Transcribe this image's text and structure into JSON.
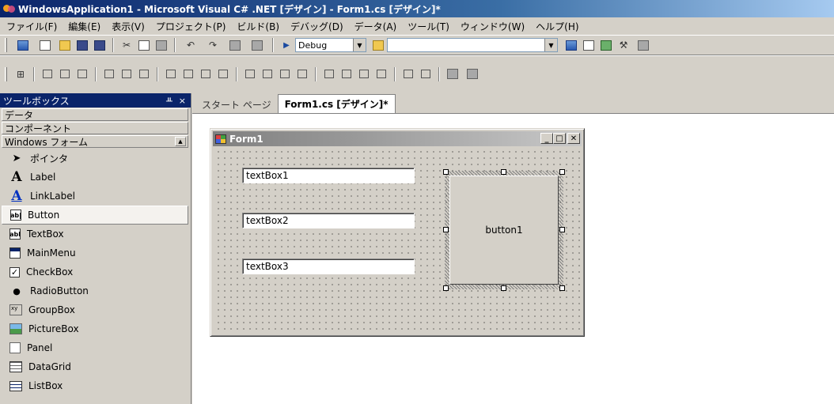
{
  "window": {
    "title": "WindowsApplication1 - Microsoft Visual C# .NET [デザイン] - Form1.cs [デザイン]*"
  },
  "menu": [
    "ファイル(F)",
    "編集(E)",
    "表示(V)",
    "プロジェクト(P)",
    "ビルド(B)",
    "デバッグ(D)",
    "データ(A)",
    "ツール(T)",
    "ウィンドウ(W)",
    "ヘルプ(H)"
  ],
  "toolbar": {
    "config_value": "Debug",
    "find_value": ""
  },
  "toolbox": {
    "title": "ツールボックス",
    "pin_glyph": "ᚇ",
    "close_glyph": "×",
    "sections": {
      "data": "データ",
      "components": "コンポーネント",
      "winforms": "Windows フォーム"
    },
    "items": [
      "ポインタ",
      "Label",
      "LinkLabel",
      "Button",
      "TextBox",
      "MainMenu",
      "CheckBox",
      "RadioButton",
      "GroupBox",
      "PictureBox",
      "Panel",
      "DataGrid",
      "ListBox"
    ],
    "icon_text": {
      "label": "A",
      "linklabel": "A",
      "button": "ab|",
      "textbox": "abl",
      "checkbox": "✓",
      "radio": "●",
      "group": "xy"
    }
  },
  "tabs": [
    "スタート ページ",
    "Form1.cs [デザイン]*"
  ],
  "form": {
    "title": "Form1",
    "textboxes": [
      "textBox1",
      "textBox2",
      "textBox3"
    ],
    "button_label": "button1"
  },
  "colors": {
    "title_active": "#0a246a",
    "form_title": "#808080",
    "face": "#d4d0c8"
  }
}
